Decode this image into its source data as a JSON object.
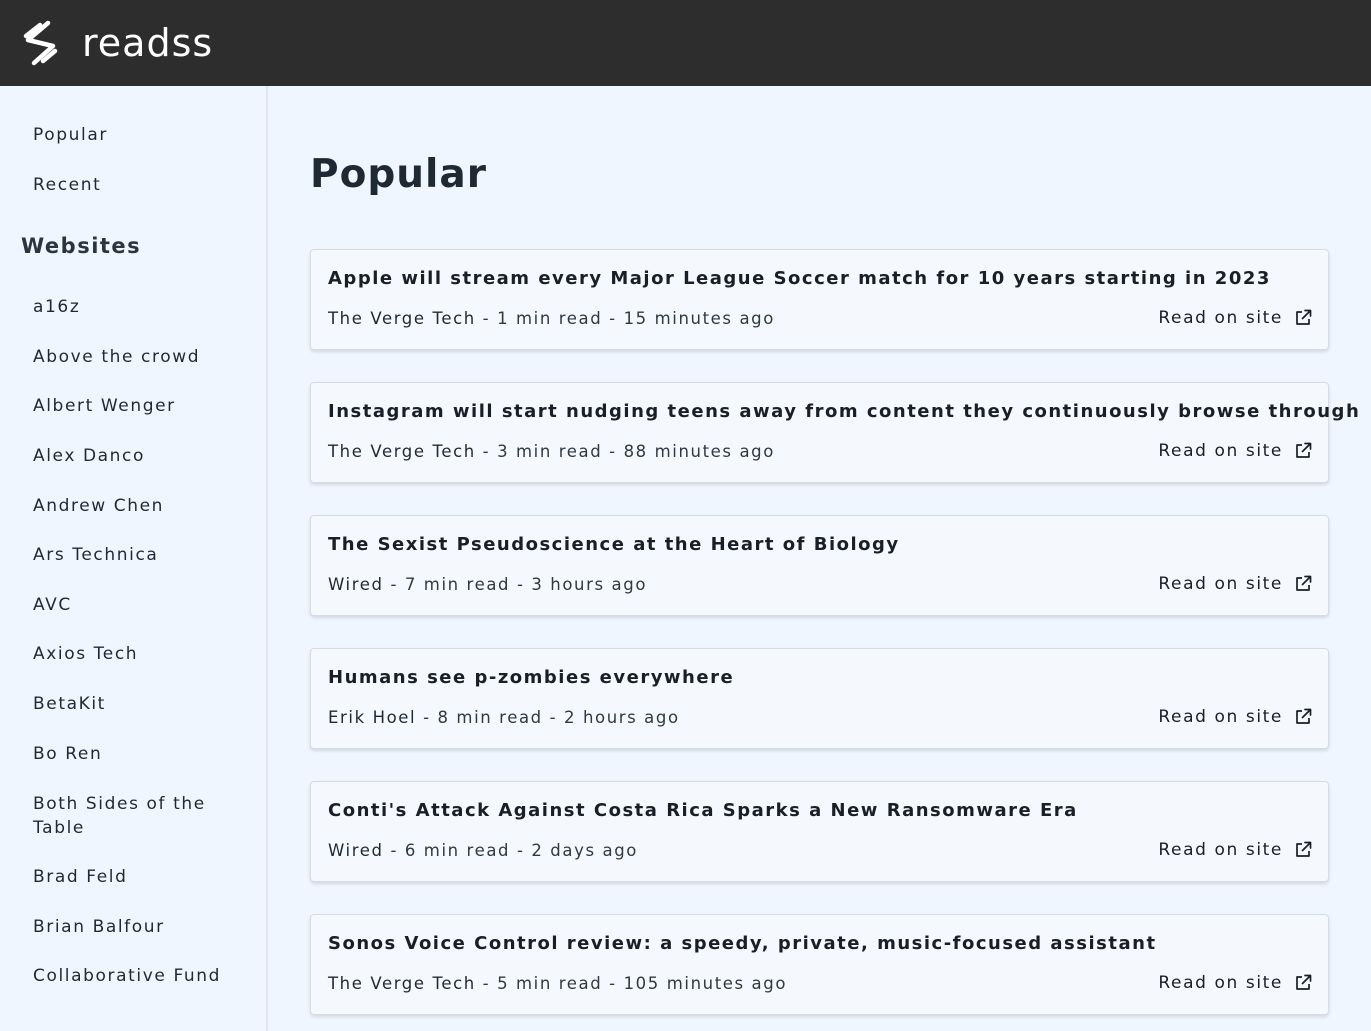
{
  "app": {
    "brand": "readss"
  },
  "sidebar": {
    "top_links": [
      {
        "label": "Popular"
      },
      {
        "label": "Recent"
      }
    ],
    "websites_heading": "Websites",
    "websites": [
      {
        "label": "a16z"
      },
      {
        "label": "Above the crowd"
      },
      {
        "label": "Albert Wenger"
      },
      {
        "label": "Alex Danco"
      },
      {
        "label": "Andrew Chen"
      },
      {
        "label": "Ars Technica"
      },
      {
        "label": "AVC"
      },
      {
        "label": "Axios Tech"
      },
      {
        "label": "BetaKit"
      },
      {
        "label": "Bo Ren"
      },
      {
        "label": "Both Sides of the Table"
      },
      {
        "label": "Brad Feld"
      },
      {
        "label": "Brian Balfour"
      },
      {
        "label": "Collaborative Fund"
      }
    ]
  },
  "main": {
    "title": "Popular",
    "read_label": "Read on site",
    "separator": " - ",
    "articles": [
      {
        "title": "Apple will stream every Major League Soccer match for 10 years starting in 2023",
        "source": "The Verge Tech",
        "read_time": "1 min read",
        "age": "15 minutes ago"
      },
      {
        "title": "Instagram will start nudging teens away from content they continuously browse through",
        "source": "The Verge Tech",
        "read_time": "3 min read",
        "age": "88 minutes ago"
      },
      {
        "title": "The Sexist Pseudoscience at the Heart of Biology",
        "source": "Wired",
        "read_time": "7 min read",
        "age": "3 hours ago"
      },
      {
        "title": "Humans see p-zombies everywhere",
        "source": "Erik Hoel",
        "read_time": "8 min read",
        "age": "2 hours ago"
      },
      {
        "title": "Conti's Attack Against Costa Rica Sparks a New Ransomware Era",
        "source": "Wired",
        "read_time": "6 min read",
        "age": "2 days ago"
      },
      {
        "title": "Sonos Voice Control review: a speedy, private, music-focused assistant",
        "source": "The Verge Tech",
        "read_time": "5 min read",
        "age": "105 minutes ago"
      }
    ]
  },
  "colors": {
    "header_bg": "#2d2d2d",
    "page_bg": "#f0f6ff",
    "card_bg": "#f5f8fc",
    "card_border": "#d7dce3",
    "text": "#1f2933"
  },
  "icons": {
    "logo": "s-logo-icon",
    "external_link": "external-link-icon"
  }
}
